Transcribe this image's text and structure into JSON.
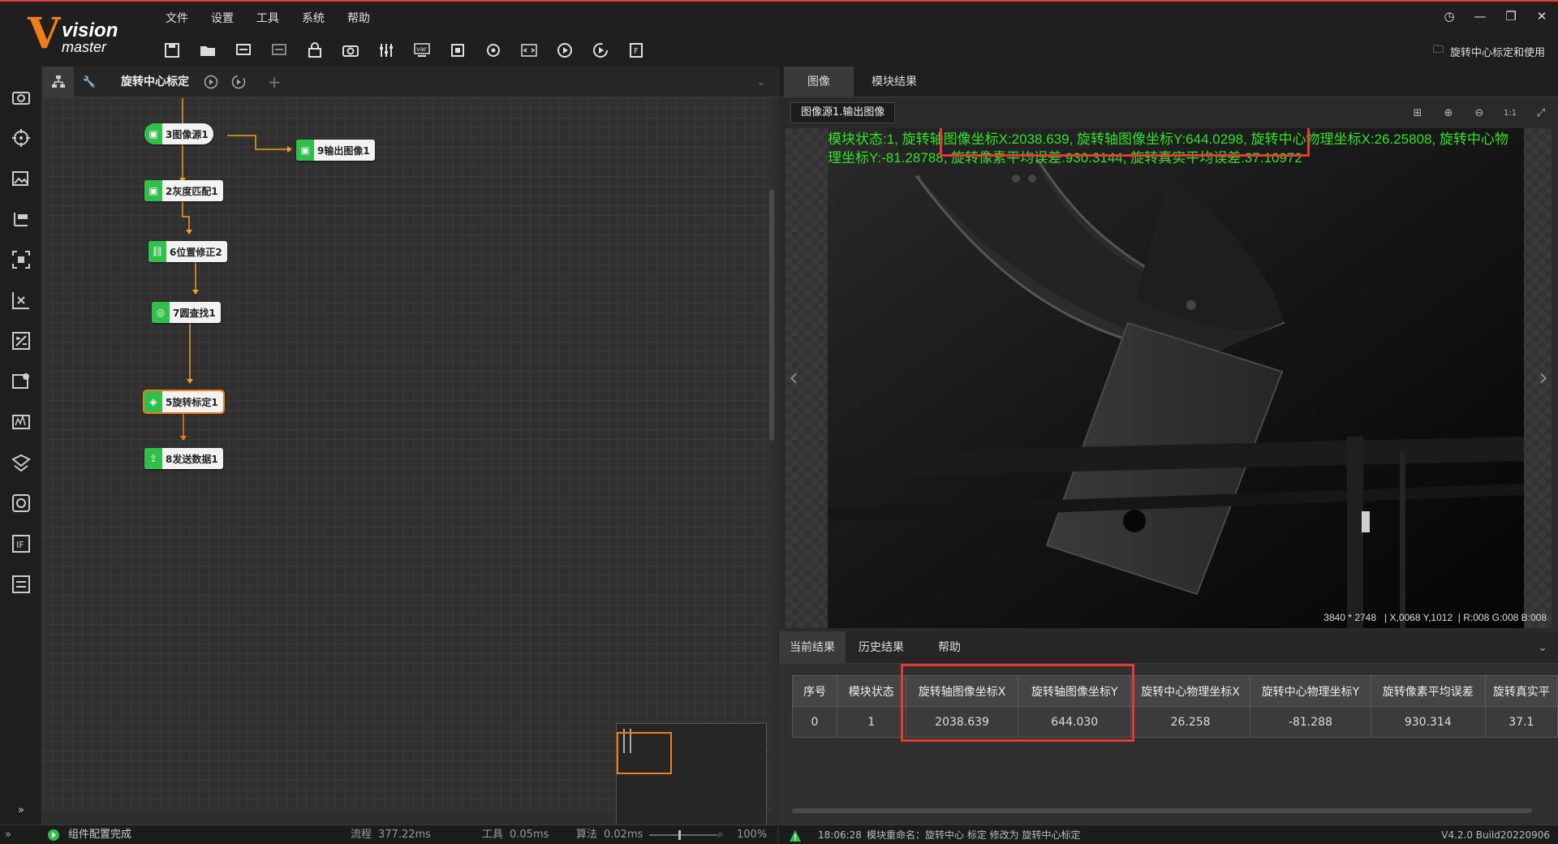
{
  "app": {
    "logo_main": "vision",
    "logo_sub": "master",
    "solution_name": "旋转中心标定和使用"
  },
  "menu": [
    "文件",
    "设置",
    "工具",
    "系统",
    "帮助"
  ],
  "toolbar_icons": [
    "save-icon",
    "open-icon",
    "save-as-icon",
    "import-icon",
    "lock-icon",
    "camera-icon",
    "controller-icon",
    "global-variable-icon",
    "communication-icon",
    "global-script-icon",
    "code-icon",
    "run-once-icon",
    "run-loop-icon",
    "client-icon"
  ],
  "sidebar_icons": [
    "image-source-icon",
    "positioning-icon",
    "image-processing-icon",
    "measurement-icon",
    "roi-icon",
    "calibration-icon",
    "contrast-icon",
    "color-icon",
    "deep-learning-icon",
    "defect-icon",
    "logic-icon",
    "if-icon",
    "communication-icon"
  ],
  "flow": {
    "title": "旋转中心标定",
    "nodes": [
      {
        "id": "n3",
        "label": "3图像源1",
        "icon": "image-icon"
      },
      {
        "id": "n9",
        "label": "9输出图像1",
        "icon": "image-export-icon"
      },
      {
        "id": "n2",
        "label": "2灰度匹配1",
        "icon": "image-icon"
      },
      {
        "id": "n6",
        "label": "6位置修正2",
        "icon": "link-icon"
      },
      {
        "id": "n7",
        "label": "7圆查找1",
        "icon": "circle-search-icon"
      },
      {
        "id": "n5",
        "label": "5旋转标定1",
        "icon": "calibration-icon"
      },
      {
        "id": "n8",
        "label": "8发送数据1",
        "icon": "send-icon"
      }
    ]
  },
  "image_panel": {
    "tabs": [
      "图像",
      "模块结果"
    ],
    "active_tab": "图像",
    "source": "图像源1.输出图像",
    "overlay_line1": "模块状态:1, 旋转轴图像坐标X:2038.639, 旋转轴图像坐标Y:644.0298, 旋转中心物理坐标X:26.25808, 旋转中心物",
    "overlay_line2": "理坐标Y:-81.28788, 旋转像素平均误差:930.3144, 旋转真实平均误差:37.10972",
    "info_size": "3840 * 2748",
    "info_xy": "X,0068  Y,1012",
    "info_rgb": "R:008  G:008  B:008"
  },
  "results": {
    "tabs": [
      "当前结果",
      "历史结果",
      "帮助"
    ],
    "active_tab": "当前结果",
    "columns": [
      "序号",
      "模块状态",
      "旋转轴图像坐标X",
      "旋转轴图像坐标Y",
      "旋转中心物理坐标X",
      "旋转中心物理坐标Y",
      "旋转像素平均误差",
      "旋转真实平"
    ],
    "rows": [
      [
        "0",
        "1",
        "2038.639",
        "644.030",
        "26.258",
        "-81.288",
        "930.314",
        "37.1"
      ]
    ]
  },
  "status_left": {
    "message": "组件配置完成",
    "flow_label": "流程",
    "flow_time": "377.22ms",
    "tool_label": "工具",
    "tool_time": "0.05ms",
    "algo_label": "算法",
    "algo_time": "0.02ms",
    "zoom": "100%"
  },
  "status_right": {
    "time": "18:06:28",
    "message": "模块重命名：旋转中心 标定 修改为 旋转中心标定",
    "version": "V4.2.0 Build20220906"
  },
  "colors": {
    "accent": "#f07c1a",
    "highlight": "#e53935",
    "overlay_text": "#35e02c",
    "node_icon": "#2fbf4a"
  }
}
